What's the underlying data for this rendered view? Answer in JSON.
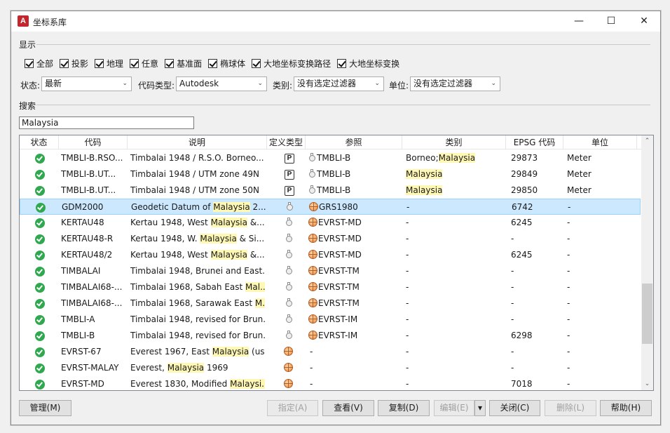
{
  "window": {
    "title": "坐标系库",
    "minimize": "—",
    "maximize": "☐",
    "close": "✕"
  },
  "display": {
    "label": "显示",
    "checkboxes": [
      "全部",
      "投影",
      "地理",
      "任意",
      "基准面",
      "椭球体",
      "大地坐标变换路径",
      "大地坐标变换"
    ]
  },
  "filters": {
    "status_label": "状态:",
    "status_value": "最新",
    "code_type_label": "代码类型:",
    "code_type_value": "Autodesk",
    "category_label": "类别:",
    "category_value": "没有选定过滤器",
    "unit_label": "单位:",
    "unit_value": "没有选定过滤器"
  },
  "search": {
    "label": "搜索",
    "value": "Malaysia"
  },
  "table": {
    "columns": [
      "状态",
      "代码",
      "说明",
      "定义类型",
      "参照",
      "类别",
      "EPSG 代码",
      "单位"
    ],
    "rows": [
      {
        "code": "TMBLI-B.RSO...",
        "desc_pre": "Timbalai 1948 / R.S.O. Borneo...",
        "desc_hl": "",
        "desc_post": "",
        "type": "P",
        "ref": "TMBLI-B",
        "ref_icon": "mini",
        "cat_pre": "Borneo;",
        "cat_hl": "Malaysia",
        "epsg": "29873",
        "unit": "Meter"
      },
      {
        "code": "TMBLI-B.UT...",
        "desc_pre": "Timbalai 1948 / UTM zone 49N",
        "desc_hl": "",
        "desc_post": "",
        "type": "P",
        "ref": "TMBLI-B",
        "ref_icon": "mini",
        "cat_pre": "",
        "cat_hl": "Malaysia",
        "epsg": "29849",
        "unit": "Meter"
      },
      {
        "code": "TMBLI-B.UT...",
        "desc_pre": "Timbalai 1948 / UTM zone 50N",
        "desc_hl": "",
        "desc_post": "",
        "type": "P",
        "ref": "TMBLI-B",
        "ref_icon": "mini",
        "cat_pre": "",
        "cat_hl": "Malaysia",
        "epsg": "29850",
        "unit": "Meter"
      },
      {
        "code": "GDM2000",
        "desc_pre": "Geodetic Datum of ",
        "desc_hl": "Malaysia",
        "desc_post": " 2...",
        "type": "G",
        "ref": "GRS1980",
        "ref_icon": "globe",
        "cat_pre": "-",
        "cat_hl": "",
        "epsg": "6742",
        "unit": "-"
      },
      {
        "code": "KERTAU48",
        "desc_pre": "Kertau 1948, West ",
        "desc_hl": "Malaysia",
        "desc_post": " &...",
        "type": "G",
        "ref": "EVRST-MD",
        "ref_icon": "globe",
        "cat_pre": "-",
        "cat_hl": "",
        "epsg": "6245",
        "unit": "-"
      },
      {
        "code": "KERTAU48-R",
        "desc_pre": "Kertau 1948, W. ",
        "desc_hl": "Malaysia",
        "desc_post": " & Si...",
        "type": "G",
        "ref": "EVRST-MD",
        "ref_icon": "globe",
        "cat_pre": "-",
        "cat_hl": "",
        "epsg": "-",
        "unit": "-"
      },
      {
        "code": "KERTAU48/2",
        "desc_pre": "Kertau 1948, West ",
        "desc_hl": "Malaysia",
        "desc_post": " &...",
        "type": "G",
        "ref": "EVRST-MD",
        "ref_icon": "globe",
        "cat_pre": "-",
        "cat_hl": "",
        "epsg": "6245",
        "unit": "-"
      },
      {
        "code": "TIMBALAI",
        "desc_pre": "Timbalai 1948, Brunei and East...",
        "desc_hl": "",
        "desc_post": "",
        "type": "G",
        "ref": "EVRST-TM",
        "ref_icon": "globe",
        "cat_pre": "-",
        "cat_hl": "",
        "epsg": "-",
        "unit": "-"
      },
      {
        "code": "TIMBALAI68-...",
        "desc_pre": "Timbalai 1968, Sabah East ",
        "desc_hl": "Mal...",
        "desc_post": "",
        "type": "G",
        "ref": "EVRST-TM",
        "ref_icon": "globe",
        "cat_pre": "-",
        "cat_hl": "",
        "epsg": "-",
        "unit": "-"
      },
      {
        "code": "TIMBALAI68-...",
        "desc_pre": "Timbalai 1968, Sarawak East ",
        "desc_hl": "M...",
        "desc_post": "",
        "type": "G",
        "ref": "EVRST-TM",
        "ref_icon": "globe",
        "cat_pre": "-",
        "cat_hl": "",
        "epsg": "-",
        "unit": "-"
      },
      {
        "code": "TMBLI-A",
        "desc_pre": "Timbalai 1948, revised for Brun...",
        "desc_hl": "",
        "desc_post": "",
        "type": "G",
        "ref": "EVRST-IM",
        "ref_icon": "globe",
        "cat_pre": "-",
        "cat_hl": "",
        "epsg": "-",
        "unit": "-"
      },
      {
        "code": "TMBLI-B",
        "desc_pre": "Timbalai 1948, revised for Brun...",
        "desc_hl": "",
        "desc_post": "",
        "type": "G",
        "ref": "EVRST-IM",
        "ref_icon": "globe",
        "cat_pre": "-",
        "cat_hl": "",
        "epsg": "6298",
        "unit": "-"
      },
      {
        "code": "EVRST-67",
        "desc_pre": "Everest 1967, East ",
        "desc_hl": "Malaysia",
        "desc_post": " (us...",
        "type": "E",
        "ref": "-",
        "ref_icon": "",
        "cat_pre": "-",
        "cat_hl": "",
        "epsg": "-",
        "unit": "-"
      },
      {
        "code": "EVRST-MALAY",
        "desc_pre": "Everest, ",
        "desc_hl": "Malaysia",
        "desc_post": " 1969",
        "type": "E",
        "ref": "-",
        "ref_icon": "",
        "cat_pre": "-",
        "cat_hl": "",
        "epsg": "-",
        "unit": "-"
      },
      {
        "code": "EVRST-MD",
        "desc_pre": "Everest 1830, Modified ",
        "desc_hl": "Malaysi...",
        "desc_post": "",
        "type": "E",
        "ref": "-",
        "ref_icon": "",
        "cat_pre": "-",
        "cat_hl": "",
        "epsg": "7018",
        "unit": "-"
      }
    ],
    "selected_index": 3
  },
  "buttons": {
    "manage": "管理(M)",
    "assign": "指定(A)",
    "view": "查看(V)",
    "copy": "复制(D)",
    "edit": "编辑(E)",
    "edit_menu": "▾",
    "close": "关闭(C)",
    "delete": "删除(L)",
    "help": "帮助(H)"
  },
  "colors": {
    "highlight": "#fff8b5",
    "selection": "#cce8ff",
    "status_ok": "#2fa84f",
    "app_icon": "#c4262e"
  }
}
